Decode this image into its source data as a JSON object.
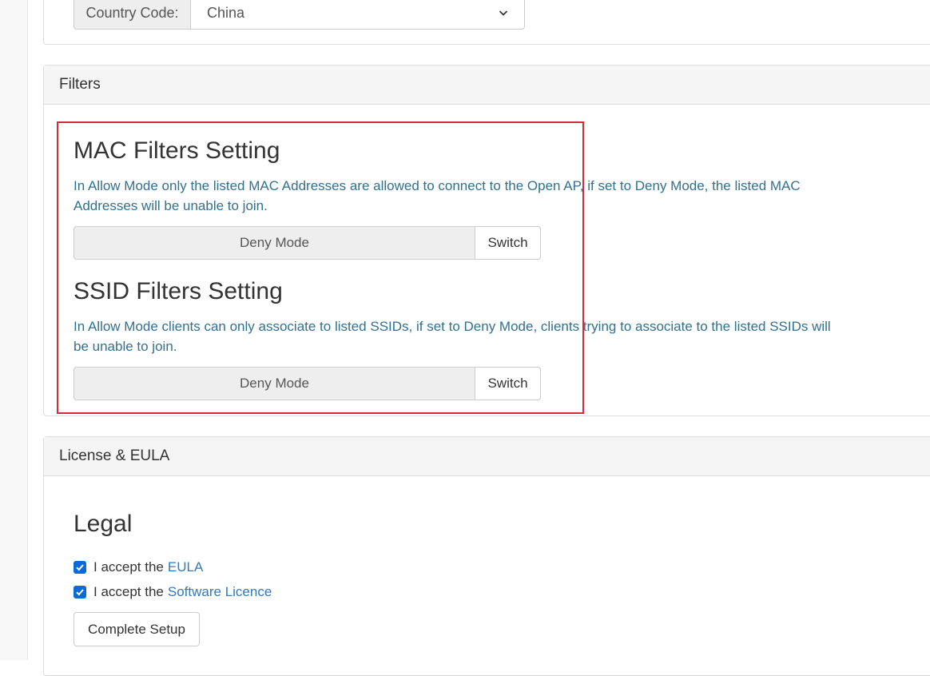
{
  "country": {
    "label": "Country Code:",
    "selected": "China"
  },
  "filters": {
    "heading": "Filters",
    "mac": {
      "title": "MAC Filters Setting",
      "help": "In Allow Mode only the listed MAC Addresses are allowed to connect to the Open AP, if set to Deny Mode, the listed MAC Addresses will be unable to join.",
      "mode": "Deny Mode",
      "switch_label": "Switch"
    },
    "ssid": {
      "title": "SSID Filters Setting",
      "help": "In Allow Mode clients can only associate to listed SSIDs, if set to Deny Mode, clients trying to associate to the listed SSIDs will be unable to join.",
      "mode": "Deny Mode",
      "switch_label": "Switch"
    }
  },
  "license": {
    "heading": "License & EULA",
    "title": "Legal",
    "eula_prefix": "I accept the",
    "eula_link": "EULA",
    "licence_prefix": "I accept the",
    "licence_link": "Software Licence",
    "complete_label": "Complete Setup"
  },
  "colors": {
    "help_text": "#31708f",
    "link": "#337ab7",
    "highlight": "#d6293e",
    "checkbox": "#0b6bd6"
  }
}
